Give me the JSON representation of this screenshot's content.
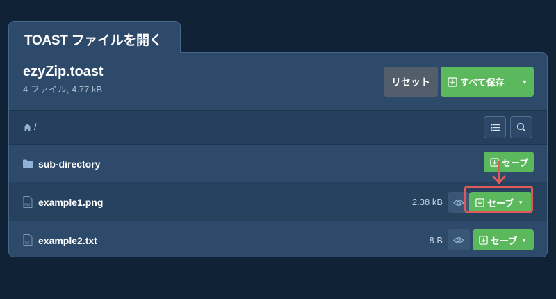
{
  "tab": {
    "title": "TOAST ファイルを開く"
  },
  "archive": {
    "name": "ezyZip.toast",
    "summary": "4 ファイル, 4.77 kB",
    "reset_label": "リセット",
    "save_all_label": "すべて保存"
  },
  "breadcrumb": {
    "separator": "/"
  },
  "files": [
    {
      "name": "sub-directory",
      "size": "",
      "type": "folder",
      "save_label": "セーブ"
    },
    {
      "name": "example1.png",
      "size": "2.38 kB",
      "type": "png",
      "badge": "PNG",
      "save_label": "セーブ"
    },
    {
      "name": "example2.txt",
      "size": "8 B",
      "type": "txt",
      "badge": "TXT",
      "save_label": "セーブ"
    }
  ],
  "colors": {
    "background": "#102236",
    "panel": "#2e4a6a",
    "save_green": "#5cb85c",
    "reset_gray": "#525e6c",
    "highlight_red": "#e05a5a"
  }
}
